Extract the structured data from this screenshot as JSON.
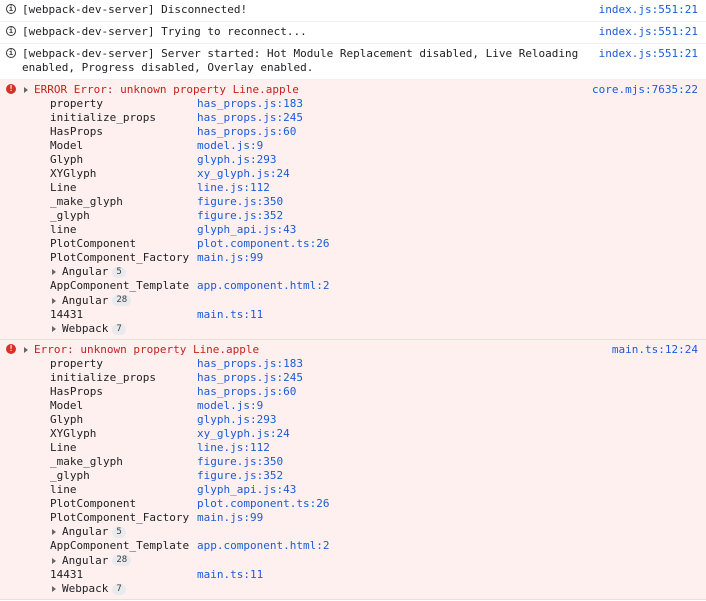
{
  "info_messages": [
    {
      "text": "[webpack-dev-server] Disconnected!",
      "source": "index.js:551:21"
    },
    {
      "text": "[webpack-dev-server] Trying to reconnect...",
      "source": "index.js:551:21"
    },
    {
      "text": "[webpack-dev-server] Server started: Hot Module Replacement disabled, Live Reloading enabled, Progress disabled, Overlay enabled.",
      "source": "index.js:551:21"
    }
  ],
  "errors": [
    {
      "message": "ERROR Error: unknown property Line.apple",
      "source": "core.mjs:7635:22",
      "frames_a": [
        {
          "fn": "property",
          "loc": "has_props.js:183"
        },
        {
          "fn": "initialize_props",
          "loc": "has_props.js:245"
        },
        {
          "fn": "HasProps",
          "loc": "has_props.js:60"
        },
        {
          "fn": "Model",
          "loc": "model.js:9"
        },
        {
          "fn": "Glyph",
          "loc": "glyph.js:293"
        },
        {
          "fn": "XYGlyph",
          "loc": "xy_glyph.js:24"
        },
        {
          "fn": "Line",
          "loc": "line.js:112"
        },
        {
          "fn": "_make_glyph",
          "loc": "figure.js:350"
        },
        {
          "fn": "_glyph",
          "loc": "figure.js:352"
        },
        {
          "fn": "line",
          "loc": "glyph_api.js:43"
        },
        {
          "fn": "PlotComponent",
          "loc": "plot.component.ts:26"
        },
        {
          "fn": "PlotComponent_Factory",
          "loc": "main.js:99"
        }
      ],
      "group1": {
        "label": "Angular",
        "count": "5"
      },
      "frame_template": {
        "fn": "AppComponent_Template",
        "loc": "app.component.html:2"
      },
      "group2": {
        "label": "Angular",
        "count": "28"
      },
      "frame_last": {
        "fn": "14431",
        "loc": "main.ts:11"
      },
      "group3": {
        "label": "Webpack",
        "count": "7"
      }
    },
    {
      "message": "Error: unknown property Line.apple",
      "source": "main.ts:12:24",
      "frames_a": [
        {
          "fn": "property",
          "loc": "has_props.js:183"
        },
        {
          "fn": "initialize_props",
          "loc": "has_props.js:245"
        },
        {
          "fn": "HasProps",
          "loc": "has_props.js:60"
        },
        {
          "fn": "Model",
          "loc": "model.js:9"
        },
        {
          "fn": "Glyph",
          "loc": "glyph.js:293"
        },
        {
          "fn": "XYGlyph",
          "loc": "xy_glyph.js:24"
        },
        {
          "fn": "Line",
          "loc": "line.js:112"
        },
        {
          "fn": "_make_glyph",
          "loc": "figure.js:350"
        },
        {
          "fn": "_glyph",
          "loc": "figure.js:352"
        },
        {
          "fn": "line",
          "loc": "glyph_api.js:43"
        },
        {
          "fn": "PlotComponent",
          "loc": "plot.component.ts:26"
        },
        {
          "fn": "PlotComponent_Factory",
          "loc": "main.js:99"
        }
      ],
      "group1": {
        "label": "Angular",
        "count": "5"
      },
      "frame_template": {
        "fn": "AppComponent_Template",
        "loc": "app.component.html:2"
      },
      "group2": {
        "label": "Angular",
        "count": "28"
      },
      "frame_last": {
        "fn": "14431",
        "loc": "main.ts:11"
      },
      "group3": {
        "label": "Webpack",
        "count": "7"
      }
    }
  ]
}
